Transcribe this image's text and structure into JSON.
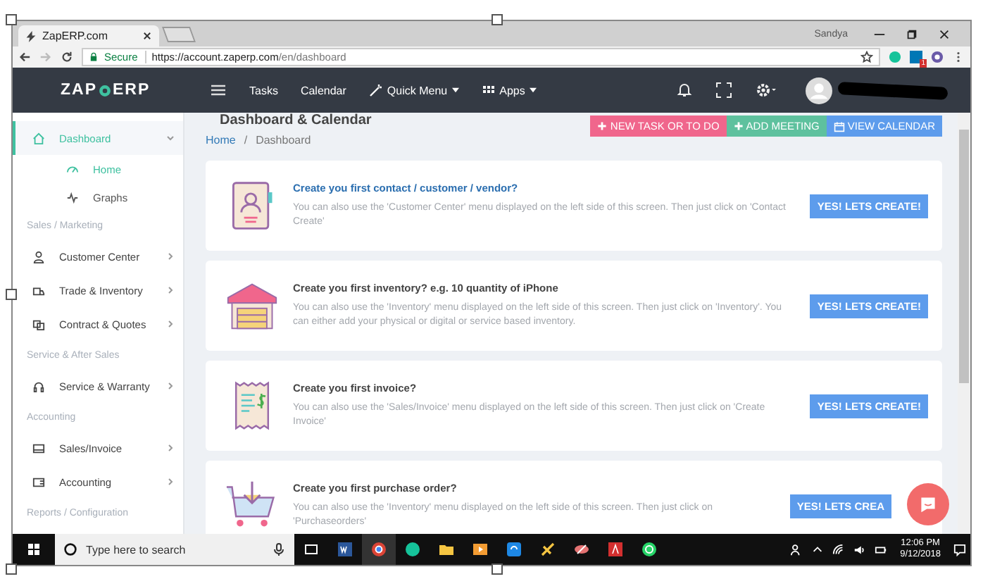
{
  "browser": {
    "tab_title": "ZapERP.com",
    "profile_name": "Sandya",
    "secure_label": "Secure",
    "url_host": "https://account.zaperp.com",
    "url_path": "/en/dashboard",
    "extension_badge": "1"
  },
  "navbar": {
    "logo_left": "ZAP",
    "logo_right": "ERP",
    "links": [
      {
        "label": "Tasks",
        "kind": "plain"
      },
      {
        "label": "Calendar",
        "kind": "plain"
      },
      {
        "label": "Quick Menu",
        "kind": "wand"
      },
      {
        "label": "Apps",
        "kind": "grid"
      }
    ]
  },
  "sidebar": {
    "items": [
      {
        "kind": "item",
        "label": "Dashboard",
        "selected": true,
        "expanded": true,
        "children": [
          {
            "label": "Home",
            "selected": true
          },
          {
            "label": "Graphs",
            "selected": false
          }
        ]
      },
      {
        "kind": "section",
        "label": "Sales / Marketing"
      },
      {
        "kind": "item",
        "label": "Customer Center",
        "selected": false,
        "expanded": false
      },
      {
        "kind": "item",
        "label": "Trade & Inventory",
        "selected": false,
        "expanded": false
      },
      {
        "kind": "item",
        "label": "Contract & Quotes",
        "selected": false,
        "expanded": false
      },
      {
        "kind": "section",
        "label": "Service & After Sales"
      },
      {
        "kind": "item",
        "label": "Service & Warranty",
        "selected": false,
        "expanded": false
      },
      {
        "kind": "section",
        "label": "Accounting"
      },
      {
        "kind": "item",
        "label": "Sales/Invoice",
        "selected": false,
        "expanded": false
      },
      {
        "kind": "item",
        "label": "Accounting",
        "selected": false,
        "expanded": false
      },
      {
        "kind": "section",
        "label": "Reports / Configuration"
      }
    ]
  },
  "page": {
    "title": "Dashboard & Calendar",
    "breadcrumb_separator": "/",
    "breadcrumb": [
      {
        "label": "Home",
        "kind": "link"
      },
      {
        "label": "Dashboard",
        "kind": "current"
      }
    ],
    "actions": [
      {
        "label": "NEW TASK OR TO DO",
        "color": "#f0668c"
      },
      {
        "label": "ADD MEETING",
        "color": "#5ec19e"
      },
      {
        "label": "VIEW CALENDAR",
        "color": "#5d9cec",
        "kind": "calendar"
      }
    ]
  },
  "cards": [
    {
      "title": "Create you first contact / customer / vendor?",
      "highlight": true,
      "text": "You can also use the 'Customer Center' menu displayed on the left side of this screen. Then just click on 'Contact Create'",
      "button": "YES! LETS CREATE!"
    },
    {
      "title": "Create you first inventory? e.g. 10 quantity of iPhone",
      "highlight": false,
      "text": "You can also use the 'Inventory' menu displayed on the left side of this screen. Then just click on 'Inventory'. You can either add your physical or digital or service based inventory.",
      "button": "YES! LETS CREATE!"
    },
    {
      "title": "Create you first invoice?",
      "highlight": false,
      "text": "You can also use the 'Sales/Invoice' menu displayed on the left side of this screen. Then just click on 'Create Invoice'",
      "button": "YES! LETS CREATE!"
    },
    {
      "title": "Create you first purchase order?",
      "highlight": false,
      "text": "You can also use the 'Inventory' menu displayed on the left side of this screen. Then just click on 'Purchaseorders'",
      "button": "YES! LETS CREA"
    }
  ],
  "taskbar": {
    "search_placeholder": "Type here to search",
    "time": "12:06 PM",
    "date": "9/12/2018"
  }
}
